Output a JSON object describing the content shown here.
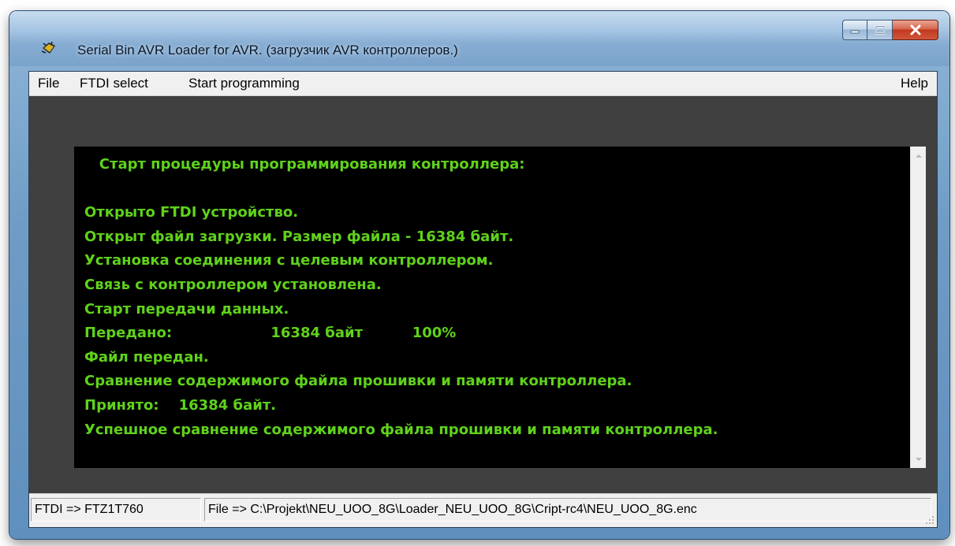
{
  "window": {
    "title": "Serial Bin AVR Loader for AVR. (загрузчик AVR контроллеров.)",
    "icons": {
      "app": "avr-chip-icon",
      "minimize": "minimize-icon",
      "maximize": "maximize-icon",
      "close": "close-icon"
    }
  },
  "menu": {
    "file": "File",
    "ftdi_select": "FTDI select",
    "start_programming": "Start programming",
    "help": "Help"
  },
  "terminal": {
    "text_color": "#5fd21a",
    "background": "#000000",
    "lines": [
      "   Старт процедуры программирования контроллера:",
      "",
      "Открыто FTDI устройство.",
      "Открыт файл загрузки. Размер файла - 16384 байт.",
      "Установка соединения с целевым контроллером.",
      "Связь с контроллером установлена.",
      "Старт передачи данных.",
      "Передано:                    16384 байт          100%",
      "Файл передан.",
      "Сравнение содержимого файла прошивки и памяти контроллера.",
      "Принято:    16384 байт.",
      "Успешное сравнение содержимого файла прошивки и памяти контроллера."
    ]
  },
  "status": {
    "ftdi": "FTDI => FTZ1T760",
    "file": "File => C:\\Projekt\\NEU_UOO_8G\\Loader_NEU_UOO_8G\\Cript-rc4\\NEU_UOO_8G.enc"
  }
}
